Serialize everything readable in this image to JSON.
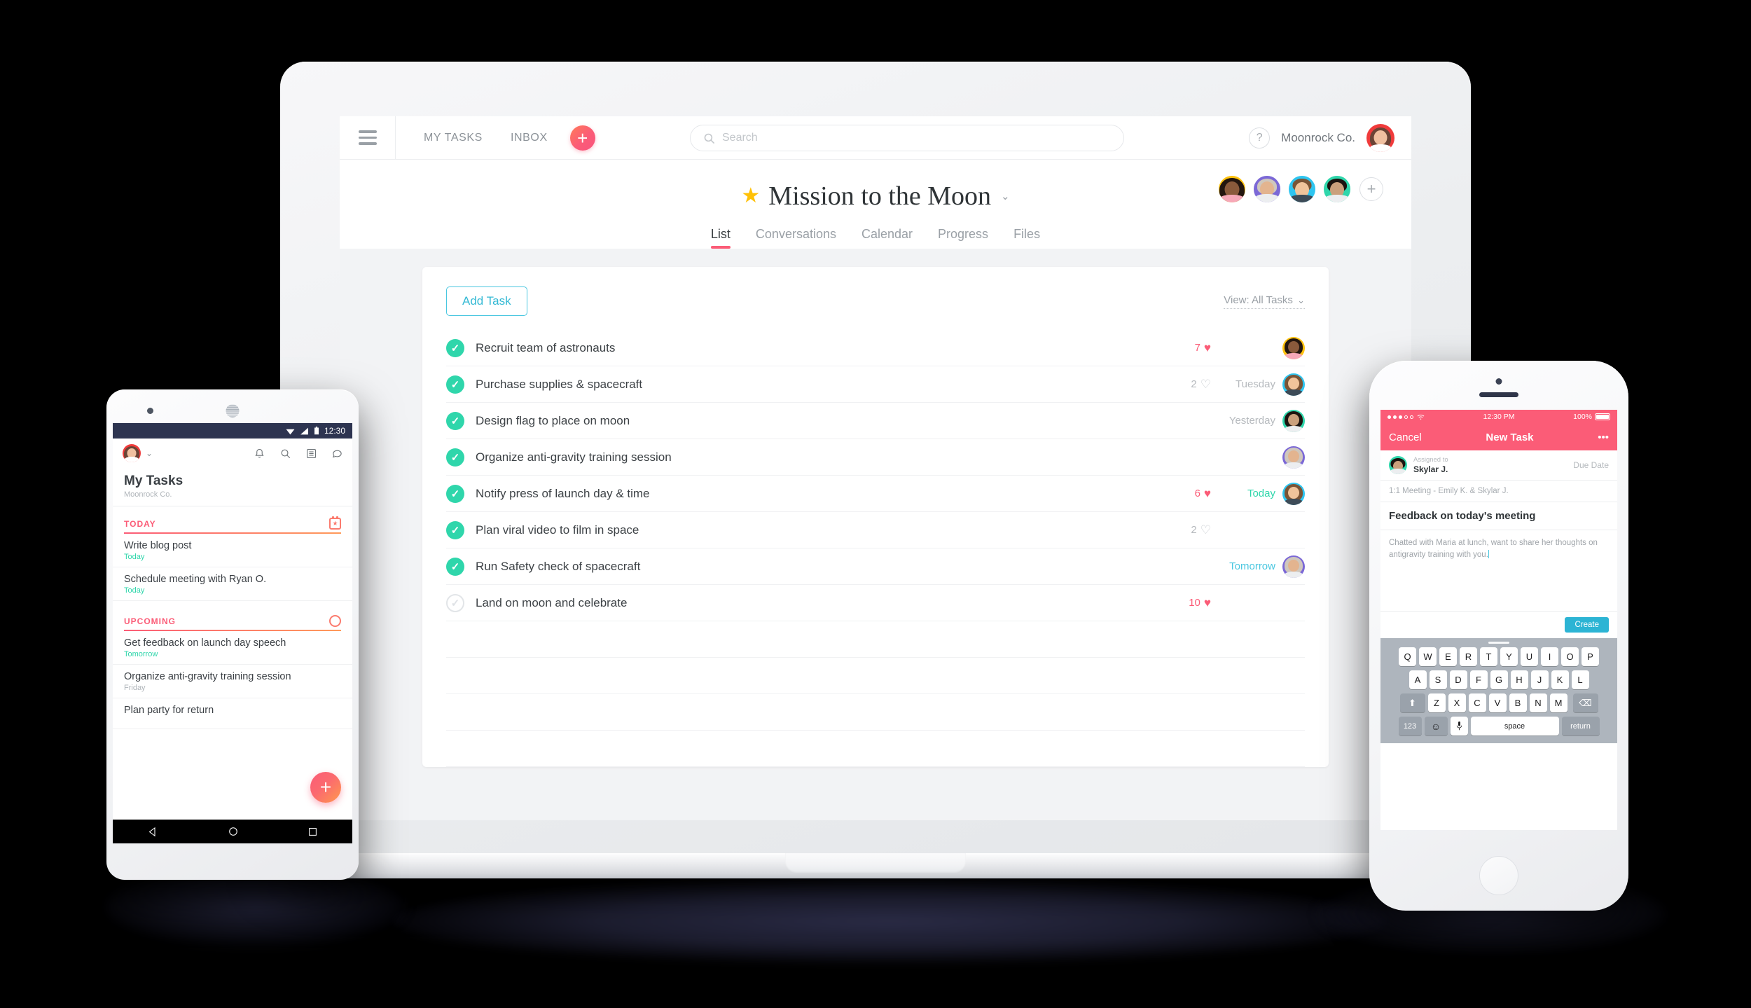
{
  "web": {
    "topbar": {
      "menu_icon": "hamburger-icon",
      "my_tasks": "MY TASKS",
      "inbox": "INBOX",
      "add_label": "+",
      "search_placeholder": "Search",
      "search_value": "",
      "search_icon": "search-icon",
      "help_label": "?",
      "org_name": "Moonrock Co."
    },
    "project": {
      "star_icon": "star-icon",
      "title": "Mission to the Moon",
      "caret": "⌄",
      "add_member": "+",
      "tabs": [
        {
          "label": "List",
          "active": true
        },
        {
          "label": "Conversations",
          "active": false
        },
        {
          "label": "Calendar",
          "active": false
        },
        {
          "label": "Progress",
          "active": false
        },
        {
          "label": "Files",
          "active": false
        }
      ],
      "members": [
        {
          "color": "#ffc20e"
        },
        {
          "color": "#7b68d6"
        },
        {
          "color": "#2ec5f0"
        },
        {
          "color": "#2fd6ab"
        }
      ]
    },
    "toolbar": {
      "add_task_label": "Add Task",
      "view_label": "View: All Tasks",
      "view_caret": "⌄"
    },
    "tasks": [
      {
        "name": "Recruit team of astronauts",
        "done": true,
        "likes": "7",
        "liked": true,
        "due": "",
        "due_style": "grey",
        "avatar": "#ffc20e"
      },
      {
        "name": "Purchase supplies & spacecraft",
        "done": true,
        "likes": "2",
        "liked": false,
        "due": "Tuesday",
        "due_style": "grey",
        "avatar": "#2ec5f0"
      },
      {
        "name": "Design flag to place on moon",
        "done": true,
        "likes": "",
        "liked": false,
        "due": "Yesterday",
        "due_style": "grey",
        "avatar": "#2fd6ab"
      },
      {
        "name": "Organize anti-gravity training session",
        "done": true,
        "likes": "",
        "liked": false,
        "due": "",
        "due_style": "grey",
        "avatar": "#7b68d6"
      },
      {
        "name": "Notify press of launch day & time",
        "done": true,
        "likes": "6",
        "liked": true,
        "due": "Today",
        "due_style": "today",
        "avatar": "#2ec5f0"
      },
      {
        "name": "Plan viral video to film in space",
        "done": true,
        "likes": "2",
        "liked": false,
        "due": "",
        "due_style": "grey",
        "avatar": ""
      },
      {
        "name": "Run Safety check of spacecraft",
        "done": true,
        "likes": "",
        "liked": false,
        "due": "Tomorrow",
        "due_style": "tomorrow",
        "avatar": "#7b68d6"
      },
      {
        "name": "Land on moon and celebrate",
        "done": false,
        "likes": "10",
        "liked": true,
        "due": "",
        "due_style": "grey",
        "avatar": ""
      }
    ]
  },
  "android": {
    "status": {
      "time": "12:30",
      "wifi_icon": "wifi-icon",
      "signal_icon": "signal-icon",
      "battery_icon": "battery-icon"
    },
    "appbar": {
      "avatar_color": "#f03b3b",
      "caret": "⌄",
      "icons": [
        "bell-icon",
        "search-icon",
        "list-icon",
        "chat-icon"
      ]
    },
    "title": "My Tasks",
    "subtitle": "Moonrock Co.",
    "sections": [
      {
        "label": "TODAY",
        "icon": "calendar-star-icon",
        "tasks": [
          {
            "name": "Write blog post",
            "due": "Today",
            "due_style": "today"
          },
          {
            "name": "Schedule meeting with Ryan O.",
            "due": "Today",
            "due_style": "today"
          }
        ]
      },
      {
        "label": "UPCOMING",
        "icon": "circle-icon",
        "tasks": [
          {
            "name": "Get feedback on launch day speech",
            "due": "Tomorrow",
            "due_style": "tomorrow"
          },
          {
            "name": "Organize anti-gravity training session",
            "due": "Friday",
            "due_style": "grey"
          },
          {
            "name": "Plan party for return",
            "due": "",
            "due_style": "grey"
          }
        ]
      }
    ],
    "fab_label": "+",
    "navbar": [
      "back-icon",
      "home-icon",
      "recents-icon"
    ]
  },
  "iphone": {
    "status": {
      "carrier_dots": "●●●○○",
      "wifi_icon": "wifi-icon",
      "time": "12:30 PM",
      "battery_pct": "100%"
    },
    "navbar": {
      "cancel": "Cancel",
      "title": "New Task",
      "more": "•••"
    },
    "assign": {
      "label": "Assigned to",
      "name": "Skylar J.",
      "due_date": "Due Date",
      "avatar_color": "#2fd6ab"
    },
    "project_line": "1:1 Meeting - Emily K. & Skylar J.",
    "task_name": "Feedback on today's meeting",
    "notes": "Chatted with Maria at lunch, want to share her thoughts on antigravity training with you.",
    "create_label": "Create",
    "keyboard": {
      "row1": [
        "Q",
        "W",
        "E",
        "R",
        "T",
        "Y",
        "U",
        "I",
        "O",
        "P"
      ],
      "row2": [
        "A",
        "S",
        "D",
        "F",
        "G",
        "H",
        "J",
        "K",
        "L"
      ],
      "row3": [
        "Z",
        "X",
        "C",
        "V",
        "B",
        "N",
        "M"
      ],
      "shift": "⬆",
      "backspace": "⌫",
      "numbers": "123",
      "emoji": "☺",
      "mic": "🎤",
      "space": "space",
      "return": "return"
    }
  },
  "colors": {
    "accent_pink": "#fb5c77",
    "accent_teal": "#2fd6ab",
    "accent_blue": "#4ac7e0",
    "star_yellow": "#ffc107",
    "android_status": "#2d3450",
    "background": "#000000"
  }
}
